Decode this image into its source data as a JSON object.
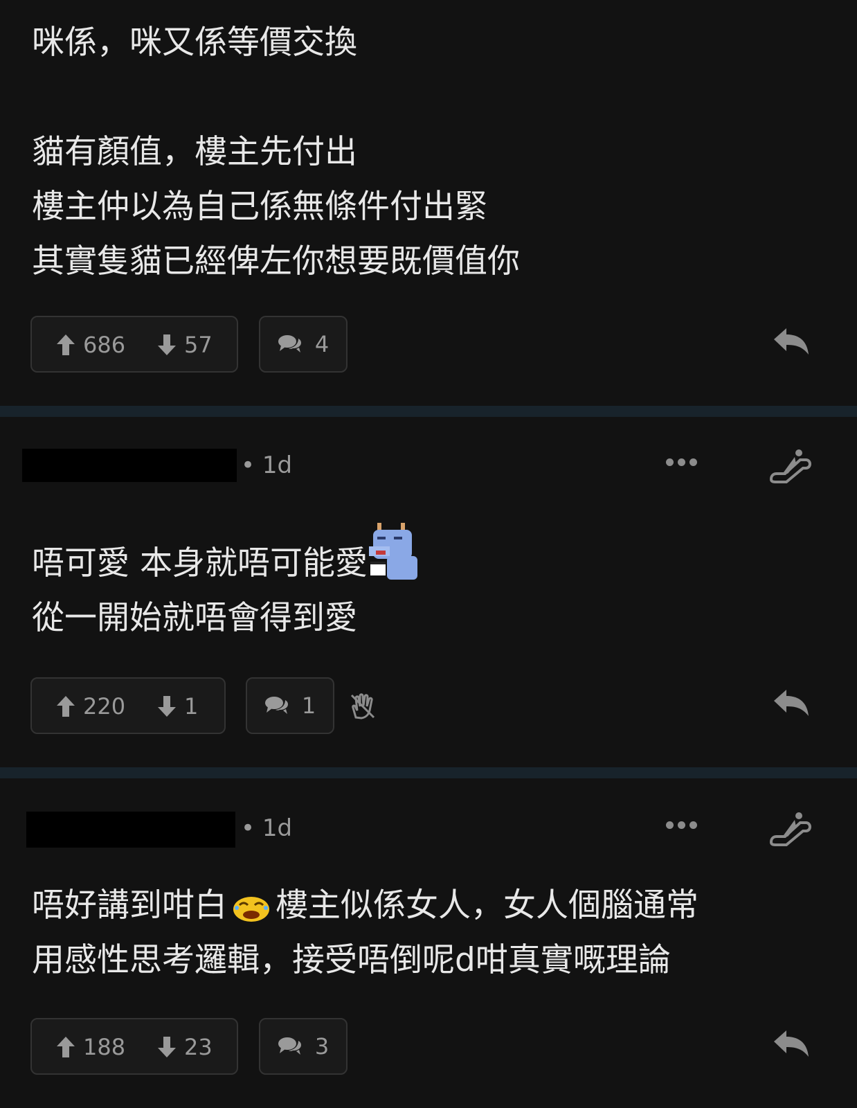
{
  "posts": [
    {
      "lines": [
        "咪係，咪又係等價交換",
        "",
        "貓有顏值，樓主先付出",
        "樓主仲以為自己係無條件付出緊",
        "其實隻貓已經俾左你想要既價值你"
      ],
      "upvotes": "686",
      "downvotes": "57",
      "comments": "4"
    },
    {
      "age": "• 1d",
      "line1": "唔可愛 本身就唔可能愛",
      "line2": "從一開始就唔會得到愛",
      "upvotes": "220",
      "downvotes": "1",
      "comments": "1"
    },
    {
      "age": "• 1d",
      "line1a": "唔好講到咁白",
      "line1b": "樓主似係女人，女人個腦通常",
      "line2": "用感性思考邏輯，接受唔倒呢d咁真實嘅理論",
      "upvotes": "188",
      "downvotes": "23",
      "comments": "3"
    }
  ],
  "colors": {
    "background": "#121212",
    "separator": "#18232b",
    "icon_gray": "#8c8c8c",
    "text": "#e8e8e8"
  },
  "icons": [
    "arrow-up-icon",
    "arrow-down-icon",
    "comment-bubbles-icon",
    "reply-icon",
    "more-dots-icon",
    "escalator-icon",
    "hand-icon",
    "dragon-sticker-icon",
    "emoji-laugh-icon"
  ]
}
